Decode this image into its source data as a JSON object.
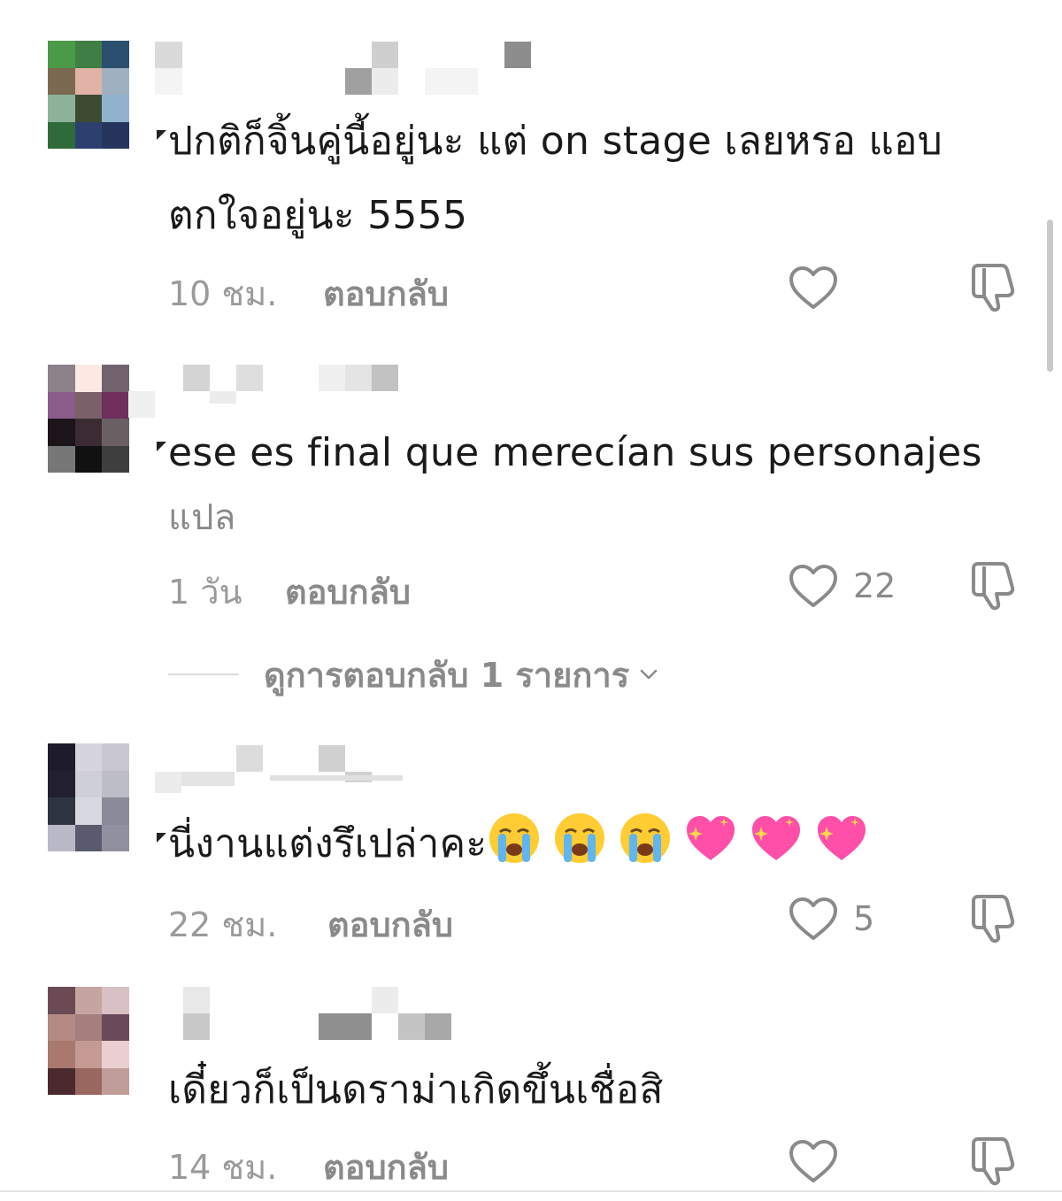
{
  "comments": [
    {
      "text": "ปกติก็จิ้นคู่นี้อยู่นะ แต่ on stage เลยหรอ แอบตกใจอยู่นะ 5555",
      "time": "10 ชม.",
      "reply_label": "ตอบกลับ",
      "likes": ""
    },
    {
      "text": "ese es final que merecían sus personajes",
      "translate": "แปล",
      "time": "1 วัน",
      "reply_label": "ตอบกลับ",
      "likes": "22",
      "view_replies": "ดูการตอบกลับ 1 รายการ"
    },
    {
      "text": "นี่งานแต่งรึเปล่าคะ",
      "emojis": [
        "loudly-crying-face",
        "loudly-crying-face",
        "loudly-crying-face",
        "sparkling-heart",
        "sparkling-heart",
        "sparkling-heart"
      ],
      "time": "22 ชม.",
      "reply_label": "ตอบกลับ",
      "likes": "5"
    },
    {
      "text": "เดี๋ยวก็เป็นดราม่าเกิดขึ้นเชื่อสิ",
      "time": "14 ชม.",
      "reply_label": "ตอบกลับ",
      "likes": ""
    }
  ],
  "icons": {
    "like": "heart-outline-icon",
    "dislike": "thumbs-down-icon",
    "chevron": "chevron-down-icon"
  },
  "colors": {
    "text": "#1a1a1a",
    "muted": "#9a9a9a",
    "reply": "#8a8a8a",
    "heart_pink": "#ff4fa8",
    "emoji_yellow": "#ffcc33"
  }
}
